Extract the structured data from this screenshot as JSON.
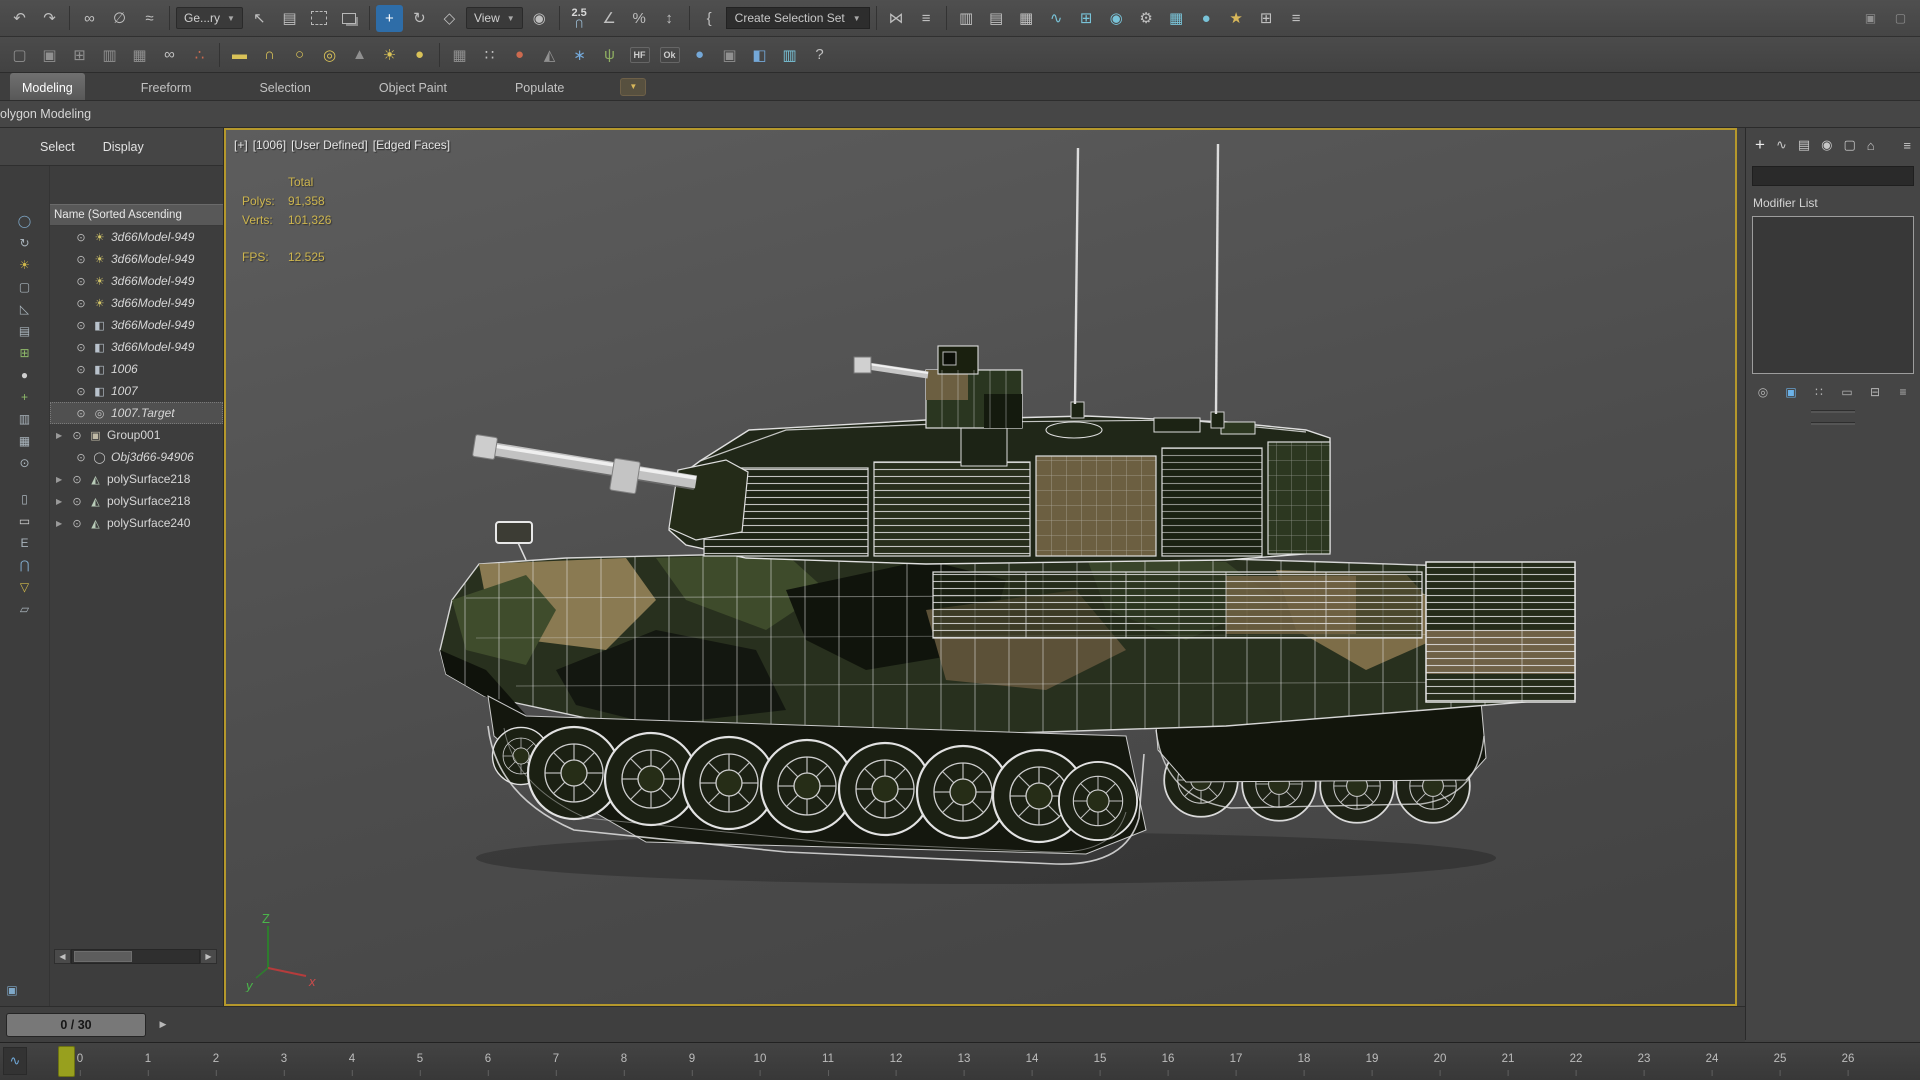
{
  "colors": {
    "viewport_border": "#b5982c",
    "stats_text": "#cdb54e",
    "selection_blue": "#2e6da8",
    "marker_green": "#98a01e"
  },
  "toolbar": {
    "geometry_filter": "Ge...ry",
    "view_label": "View",
    "snap_value": "2.5",
    "selection_set_value": "Create Selection Set"
  },
  "ribbon": {
    "tabs": [
      "Modeling",
      "Freeform",
      "Selection",
      "Object Paint",
      "Populate"
    ],
    "panel_strip": "olygon Modeling"
  },
  "scene_explorer": {
    "menu_select": "Select",
    "menu_display": "Display",
    "column_header": "Name (Sorted Ascending",
    "glyphs": {
      "eye": "⊙",
      "light": "☀",
      "camera": "◧",
      "target": "◎",
      "group": "▣",
      "object": "◯",
      "geometry": "◭",
      "expand": "▶"
    },
    "items": [
      {
        "label": "3d66Model-949"
      },
      {
        "label": "3d66Model-949"
      },
      {
        "label": "3d66Model-949"
      },
      {
        "label": "3d66Model-949"
      },
      {
        "label": "3d66Model-949"
      },
      {
        "label": "3d66Model-949"
      },
      {
        "label": "1006"
      },
      {
        "label": "1007"
      },
      {
        "label": "1007.Target"
      },
      {
        "label": "Group001"
      },
      {
        "label": "Obj3d66-94906"
      },
      {
        "label": "polySurface218"
      },
      {
        "label": "polySurface218"
      },
      {
        "label": "polySurface240"
      }
    ]
  },
  "viewport": {
    "label": {
      "menu": "[+]",
      "camera": "[1006]",
      "shading": "[User Defined]",
      "style": "[Edged Faces]"
    },
    "stats": {
      "total_label": "Total",
      "polys_label": "Polys:",
      "polys_value": "91,358",
      "verts_label": "Verts:",
      "verts_value": "101,326",
      "fps_label": "FPS:",
      "fps_value": "12.525"
    },
    "axis": {
      "x": "x",
      "y": "y",
      "z": "Z"
    }
  },
  "command_panel": {
    "modifier_list_label": "Modifier List"
  },
  "timeline": {
    "frame_display": "0 / 30",
    "ticks": [
      "0",
      "1",
      "2",
      "3",
      "4",
      "5",
      "6",
      "7",
      "8",
      "9",
      "10",
      "11",
      "12",
      "13",
      "14",
      "15",
      "16",
      "17",
      "18",
      "19",
      "20",
      "21",
      "22",
      "23",
      "24",
      "25",
      "26"
    ]
  },
  "icons": {
    "undo": "↶",
    "redo": "↷",
    "link": "∞",
    "unlink": "∅",
    "bind": "≈",
    "cursor": "↖",
    "by_name": "▤",
    "move": "+",
    "rotate": "↻",
    "scale": "◇",
    "pivot": "◉",
    "chevron_down": "▼",
    "magnet": "⋂",
    "angle_snap": "∠",
    "percent_snap": "%",
    "spinner_snap": "↕",
    "named_sets": "{",
    "mirror": "⋈",
    "align": "≡",
    "scene_explorer": "▥",
    "layer_manager": "▤",
    "ribbon_toggle": "▦",
    "curve_editor": "∿",
    "schematic": "⊞",
    "material_editor": "◉",
    "render_setup": "⚙",
    "rendered_frame": "▦",
    "render": "●",
    "wand": "★",
    "grid_helper": "⊞",
    "script": "≡",
    "win_a": "▢",
    "win_b": "▣",
    "win_grid": "⊞",
    "win_cols": "▥",
    "win_mon": "▦",
    "paint_link": "∞",
    "populate_people": "∴",
    "prim_box": "▬",
    "prim_dome": "∩",
    "prim_sphere": "●",
    "prim_torus": "◎",
    "prim_cone": "▲",
    "prim_sun": "☀",
    "prim_circle": "○",
    "lattice": "▦",
    "particles": "∷",
    "mat_red": "●",
    "pyramid": "◭",
    "flake": "∗",
    "plant": "ψ",
    "hf_badge": "HF",
    "ok_badge": "Ok",
    "sphere_blue": "●",
    "container": "▣",
    "uvw": "◧",
    "chart": "▥",
    "help": "?",
    "ls_all": "◯",
    "ls_refresh": "↻",
    "ls_lights": "☀",
    "ls_display": "▢",
    "ls_ruler": "◺",
    "ls_layers": "▤",
    "ls_addbox": "⊞",
    "ls_sphere": "●",
    "ls_plus": "+",
    "ls_cols": "▥",
    "ls_grid": "▦",
    "ls_eye": "⊙",
    "ls_page": "▯",
    "ls_rect": "▭",
    "ls_e": "E",
    "ls_magnet": "⋂",
    "ls_filter": "▽",
    "ls_para": "▱",
    "rp_create": "+",
    "rp_modify": "∿",
    "rp_hierarchy": "▤",
    "rp_motion": "◉",
    "rp_display": "▢",
    "rp_utility": "⌂",
    "rp_menu": "≡",
    "st_pin": "◎",
    "st_show": "▣",
    "st_unique": "∷",
    "st_remove": "▭",
    "st_config": "⊟",
    "arrow_right": "▶",
    "arrow_left": "◀",
    "curve_mini": "∿"
  }
}
